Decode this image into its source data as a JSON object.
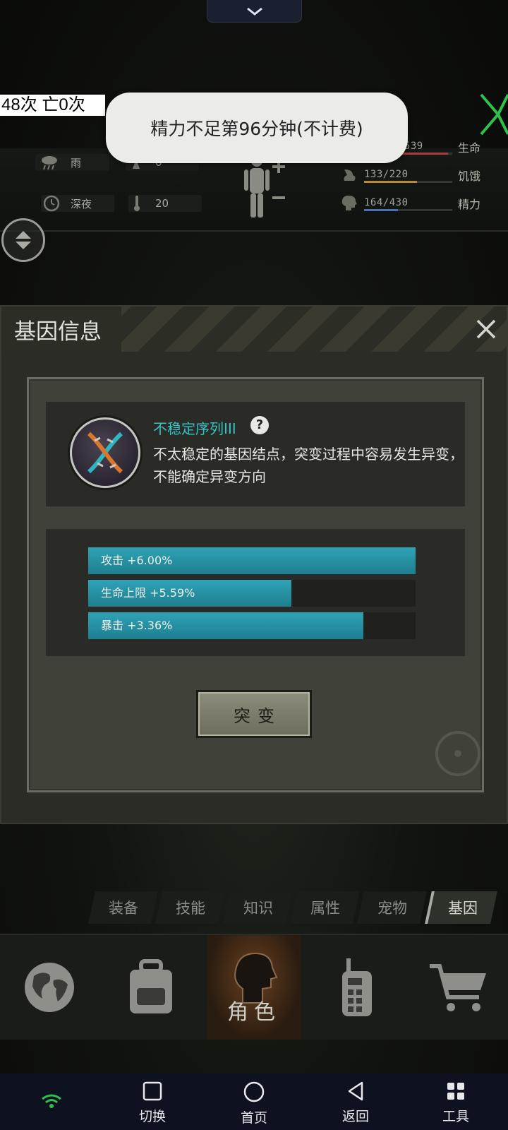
{
  "overlay": {
    "counter": "48次 亡0次",
    "toast": "精力不足第96分钟(不计费)"
  },
  "hud": {
    "weather": "雨",
    "unknown_value": "0",
    "time_of_day": "深夜",
    "temperature": "20",
    "stats": [
      {
        "label": "生命",
        "value": "6539",
        "fraction": 0.95,
        "color": "#b23a3a"
      },
      {
        "label": "饥饿",
        "value": "133/220",
        "fraction": 0.6,
        "color": "#b58a3a"
      },
      {
        "label": "精力",
        "value": "164/430",
        "fraction": 0.38,
        "color": "#4a6fb2"
      }
    ]
  },
  "dialog": {
    "title": "基因信息",
    "gene": {
      "name": "不稳定序列III",
      "help": "?",
      "description": "不太稳定的基因结点，突变过程中容易发生异变，不能确定异变方向"
    },
    "attributes": [
      {
        "label": "攻击 +6.00%",
        "fraction": 1.0
      },
      {
        "label": "生命上限 +5.59%",
        "fraction": 0.62
      },
      {
        "label": "暴击 +3.36%",
        "fraction": 0.84
      }
    ],
    "mutate_label": "突变"
  },
  "tabs": [
    {
      "label": "装备",
      "active": false
    },
    {
      "label": "技能",
      "active": false
    },
    {
      "label": "知识",
      "active": false
    },
    {
      "label": "属性",
      "active": false
    },
    {
      "label": "宠物",
      "active": false
    },
    {
      "label": "基因",
      "active": true
    }
  ],
  "nav": {
    "role_label": "角色"
  },
  "system_nav": {
    "switch": "切换",
    "home": "首页",
    "back": "返回",
    "tools": "工具"
  },
  "colors": {
    "accent_teal": "#36c3c6",
    "bar_fill": "#2fa3b6"
  }
}
